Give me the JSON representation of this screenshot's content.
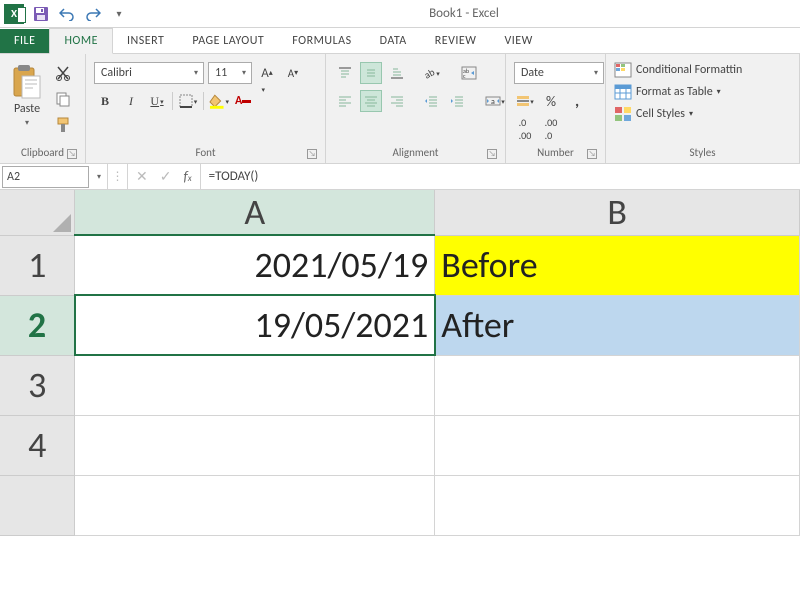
{
  "title": "Book1 - Excel",
  "tabs": {
    "file": "FILE",
    "home": "HOME",
    "insert": "INSERT",
    "pagelayout": "PAGE LAYOUT",
    "formulas": "FORMULAS",
    "data": "DATA",
    "review": "REVIEW",
    "view": "VIEW"
  },
  "clipboard": {
    "paste": "Paste",
    "label": "Clipboard"
  },
  "font": {
    "name": "Calibri",
    "size": "11",
    "label": "Font"
  },
  "alignment": {
    "label": "Alignment"
  },
  "number": {
    "format": "Date",
    "label": "Number"
  },
  "styles": {
    "conditional": "Conditional Formattin",
    "table": "Format as Table",
    "cell": "Cell Styles",
    "label": "Styles"
  },
  "namebox": "A2",
  "formula": "=TODAY()",
  "grid": {
    "cols": [
      "A",
      "B"
    ],
    "rows": [
      "1",
      "2",
      "3",
      "4"
    ],
    "cells": {
      "A1": "2021/05/19",
      "B1": "Before",
      "A2": "19/05/2021",
      "B2": "After"
    },
    "active": "A2"
  }
}
